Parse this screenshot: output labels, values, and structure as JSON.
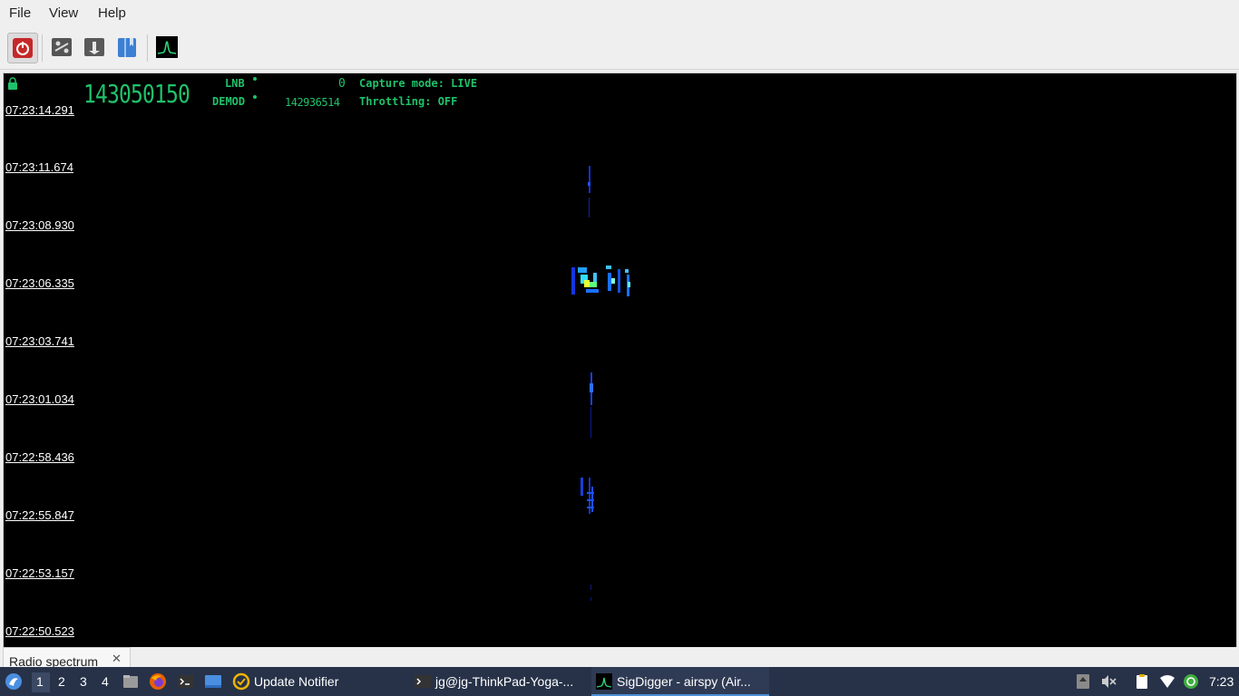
{
  "menu": {
    "file": "File",
    "view": "View",
    "help": "Help"
  },
  "toolbar": {
    "icons": [
      "power-icon",
      "settings-panel-icon",
      "record-icon",
      "bookmark-icon",
      "spectrum-icon"
    ]
  },
  "header": {
    "frequency": "143050150",
    "lnb_label": "LNB",
    "lnb_value": "0",
    "demod_label": "DEMOD",
    "demod_value": "142936514",
    "capture_mode": "Capture mode: LIVE",
    "throttling": "Throttling: OFF"
  },
  "waterfall": {
    "timestamps": [
      "07:23:14.291",
      "07:23:11.674",
      "07:23:08.930",
      "07:23:06.335",
      "07:23:03.741",
      "07:23:01.034",
      "07:22:58.436",
      "07:22:55.847",
      "07:22:53.157",
      "07:22:50.523"
    ]
  },
  "tabs": [
    {
      "label": "Radio spectrum"
    }
  ],
  "taskbar": {
    "workspaces": [
      "1",
      "2",
      "3",
      "4"
    ],
    "active_workspace": "1",
    "tasks": [
      {
        "label": "Update Notifier"
      },
      {
        "label": "jg@jg-ThinkPad-Yoga-..."
      },
      {
        "label": "SigDigger - airspy (Air..."
      }
    ],
    "clock": "7:23"
  },
  "colors": {
    "accent_green": "#1fc26a",
    "taskbar_bg": "#273248",
    "waterfall_bg": "#000000"
  }
}
